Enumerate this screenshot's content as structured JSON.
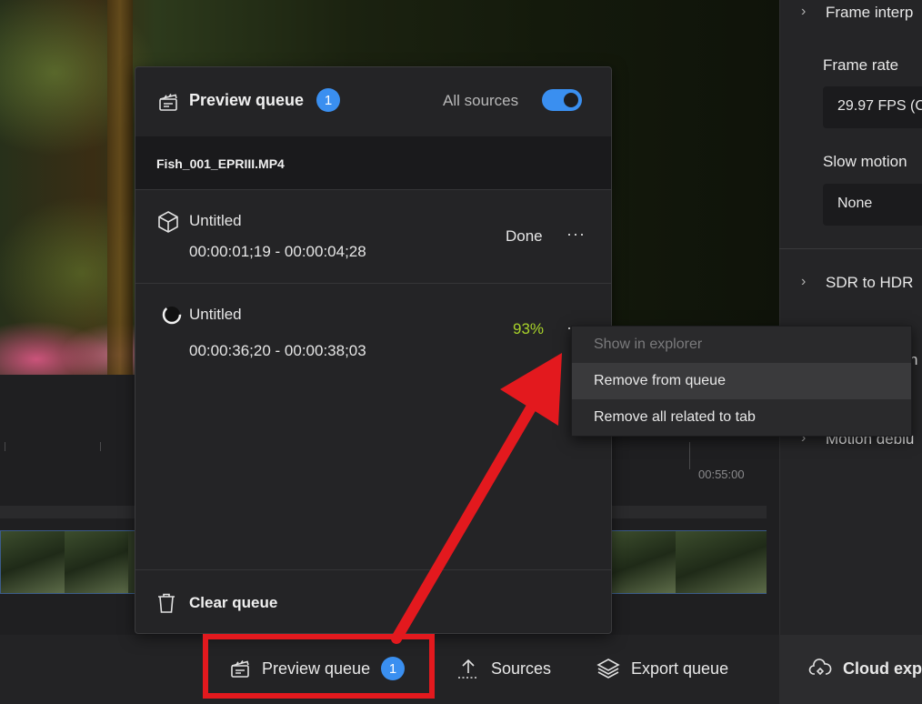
{
  "popup": {
    "title": "Preview queue",
    "count": "1",
    "all_sources_label": "All sources",
    "all_sources_on": true,
    "file_name": "Fish_001_EPRIII.MP4",
    "items": [
      {
        "name": "Untitled",
        "time_range": "00:00:01;19 - 00:00:04;28",
        "status": "Done",
        "icon": "cube-icon"
      },
      {
        "name": "Untitled",
        "time_range": "00:00:36;20 - 00:00:38;03",
        "status": "93%",
        "icon": "spinner-icon"
      }
    ],
    "clear_label": "Clear queue"
  },
  "context_menu": {
    "items": [
      {
        "label": "Show in explorer",
        "disabled": true
      },
      {
        "label": "Remove from queue",
        "hovered": true
      },
      {
        "label": "Remove all related to tab"
      }
    ]
  },
  "timeline": {
    "end_time": "00:55:00"
  },
  "right_panel": {
    "frame_interp": "Frame interp",
    "frame_rate_label": "Frame rate",
    "frame_rate_value": "29.97 FPS (C",
    "slow_motion_label": "Slow motion",
    "slow_motion_value": "None",
    "sdr_hdr": "SDR to HDR",
    "partial": "n",
    "motion_deblur": "Motion deblu"
  },
  "bottom_bar": {
    "preview_queue_label": "Preview queue",
    "preview_queue_count": "1",
    "sources_label": "Sources",
    "export_queue_label": "Export queue",
    "cloud_export_label": "Cloud exp"
  },
  "colors": {
    "accent": "#3a8ff0",
    "progress": "#a8d22a",
    "highlight": "#e3191e"
  }
}
